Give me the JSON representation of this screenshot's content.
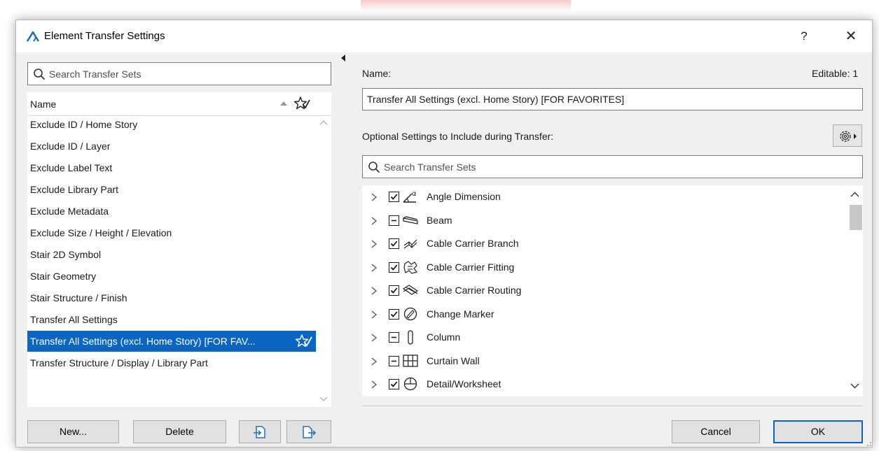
{
  "window": {
    "title": "Element Transfer Settings",
    "help_label": "?",
    "close_label": "✕"
  },
  "icons": {
    "app": "archicad-icon",
    "search": "search-icon",
    "sort": "sort-ascending-icon",
    "favorite": "favorite-star-icon",
    "gear": "gear-menu-icon",
    "import": "import-icon",
    "export": "export-icon",
    "checked": "checkbox-checked-icon",
    "partial": "checkbox-partial-icon"
  },
  "colors": {
    "selection": "#0a66c2",
    "accent": "#1f6fbf"
  },
  "left": {
    "search_placeholder": "Search Transfer Sets",
    "column_header": "Name",
    "items": [
      {
        "label": "Exclude ID / Home Story"
      },
      {
        "label": "Exclude ID / Layer"
      },
      {
        "label": "Exclude Label Text"
      },
      {
        "label": "Exclude Library Part"
      },
      {
        "label": "Exclude Metadata"
      },
      {
        "label": "Exclude Size / Height / Elevation"
      },
      {
        "label": "Stair 2D Symbol"
      },
      {
        "label": "Stair Geometry"
      },
      {
        "label": "Stair Structure / Finish"
      },
      {
        "label": "Transfer All Settings"
      },
      {
        "label": "Transfer All Settings (excl. Home Story) [FOR FAV...",
        "selected": true,
        "favorite": true
      },
      {
        "label": "Transfer Structure / Display / Library Part"
      }
    ],
    "buttons": {
      "new": "New...",
      "delete": "Delete"
    }
  },
  "right": {
    "name_label": "Name:",
    "editable_label": "Editable: 1",
    "name_value": "Transfer All Settings (excl. Home Story) [FOR FAVORITES]",
    "optional_label": "Optional Settings to Include during Transfer:",
    "search_placeholder": "Search Transfer Sets",
    "elements": [
      {
        "label": "Angle Dimension",
        "state": "checked",
        "icon": "angle-dimension-icon"
      },
      {
        "label": "Beam",
        "state": "partial",
        "icon": "beam-icon"
      },
      {
        "label": "Cable Carrier Branch",
        "state": "checked",
        "icon": "cable-carrier-branch-icon"
      },
      {
        "label": "Cable Carrier Fitting",
        "state": "checked",
        "icon": "cable-carrier-fitting-icon"
      },
      {
        "label": "Cable Carrier Routing",
        "state": "checked",
        "icon": "cable-carrier-routing-icon"
      },
      {
        "label": "Change Marker",
        "state": "checked",
        "icon": "change-marker-icon"
      },
      {
        "label": "Column",
        "state": "partial",
        "icon": "column-icon"
      },
      {
        "label": "Curtain Wall",
        "state": "partial",
        "icon": "curtain-wall-icon"
      },
      {
        "label": "Detail/Worksheet",
        "state": "checked",
        "icon": "detail-worksheet-icon"
      }
    ],
    "buttons": {
      "cancel": "Cancel",
      "ok": "OK"
    }
  }
}
